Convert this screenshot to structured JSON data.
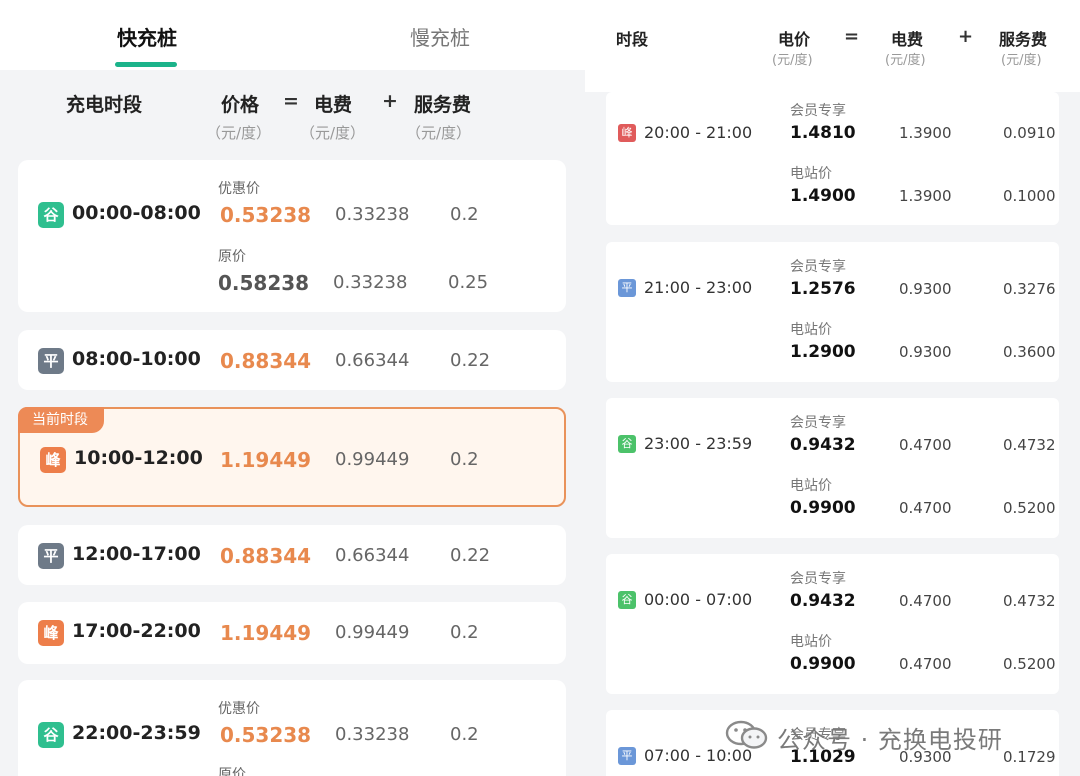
{
  "left": {
    "tabs": [
      {
        "label": "快充桩",
        "active": true
      },
      {
        "label": "慢充桩",
        "active": false
      }
    ],
    "header": {
      "period": "充电时段",
      "price": "价格",
      "eq": "=",
      "elec": "电费",
      "plus": "+",
      "service": "服务费",
      "unit": "（元/度）"
    },
    "current_label": "当前时段",
    "rows": [
      {
        "badge": "谷",
        "time": "00:00-08:00",
        "promo_label": "优惠价",
        "promo_price": "0.53238",
        "promo_elec": "0.33238",
        "promo_service": "0.2",
        "orig_label": "原价",
        "orig_price": "0.58238",
        "orig_elec": "0.33238",
        "orig_service": "0.25"
      },
      {
        "badge": "平",
        "time": "08:00-10:00",
        "price": "0.88344",
        "elec": "0.66344",
        "service": "0.22"
      },
      {
        "badge": "峰",
        "time": "10:00-12:00",
        "price": "1.19449",
        "elec": "0.99449",
        "service": "0.2"
      },
      {
        "badge": "平",
        "time": "12:00-17:00",
        "price": "0.88344",
        "elec": "0.66344",
        "service": "0.22"
      },
      {
        "badge": "峰",
        "time": "17:00-22:00",
        "price": "1.19449",
        "elec": "0.99449",
        "service": "0.2"
      },
      {
        "badge": "谷",
        "time": "22:00-23:59",
        "promo_label": "优惠价",
        "promo_price": "0.53238",
        "promo_elec": "0.33238",
        "promo_service": "0.2",
        "orig_label": "原价"
      }
    ]
  },
  "right": {
    "header": {
      "period": "时段",
      "price": "电价",
      "eq": "=",
      "elec": "电费",
      "plus": "+",
      "service": "服务费",
      "unit": "(元/度)"
    },
    "rows": [
      {
        "badge": "峰",
        "time": "20:00 - 21:00",
        "member_label": "会员专享",
        "member_price": "1.4810",
        "member_elec": "1.3900",
        "member_service": "0.0910",
        "station_label": "电站价",
        "station_price": "1.4900",
        "station_elec": "1.3900",
        "station_service": "0.1000"
      },
      {
        "badge": "平",
        "time": "21:00 - 23:00",
        "member_label": "会员专享",
        "member_price": "1.2576",
        "member_elec": "0.9300",
        "member_service": "0.3276",
        "station_label": "电站价",
        "station_price": "1.2900",
        "station_elec": "0.9300",
        "station_service": "0.3600"
      },
      {
        "badge": "谷",
        "time": "23:00 - 23:59",
        "member_label": "会员专享",
        "member_price": "0.9432",
        "member_elec": "0.4700",
        "member_service": "0.4732",
        "station_label": "电站价",
        "station_price": "0.9900",
        "station_elec": "0.4700",
        "station_service": "0.5200"
      },
      {
        "badge": "谷",
        "time": "00:00 - 07:00",
        "member_label": "会员专享",
        "member_price": "0.9432",
        "member_elec": "0.4700",
        "member_service": "0.4732",
        "station_label": "电站价",
        "station_price": "0.9900",
        "station_elec": "0.4700",
        "station_service": "0.5200"
      },
      {
        "badge": "平",
        "time": "07:00 - 10:00",
        "member_label": "会员专享",
        "member_price": "1.1029",
        "member_elec": "0.9300",
        "member_service": "0.1729"
      }
    ]
  },
  "watermark": {
    "text": "公众号 · 充换电投研",
    "icon": "wechat-icon"
  },
  "colors": {
    "accent": "#1bb38a",
    "price": "#e8894e",
    "current_border": "#e9925a"
  }
}
